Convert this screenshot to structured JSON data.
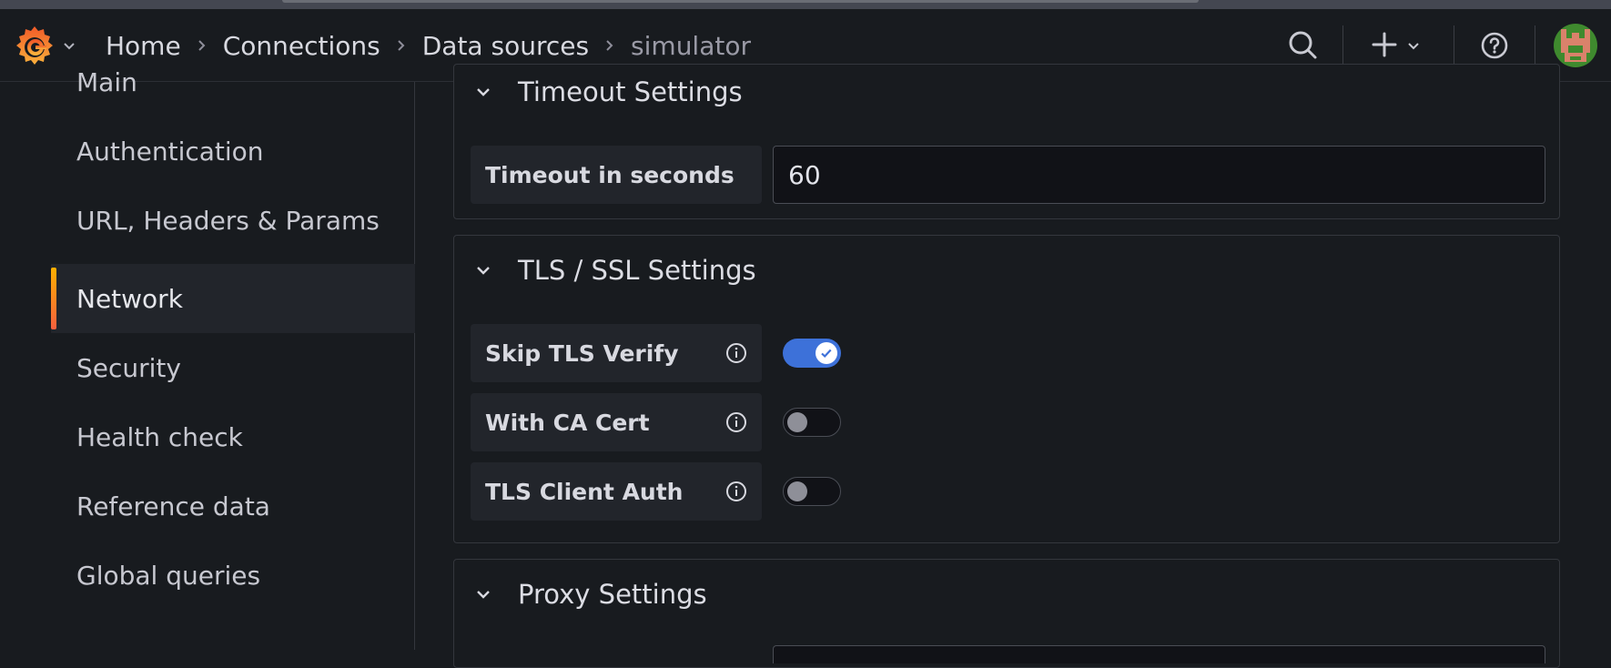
{
  "breadcrumb": {
    "items": [
      "Home",
      "Connections",
      "Data sources"
    ],
    "current": "simulator"
  },
  "icons": {
    "logo": "grafana-logo",
    "search": "search-icon",
    "add": "plus-icon",
    "help": "help-icon",
    "avatar": "user-avatar"
  },
  "sidebar": {
    "items": [
      {
        "label": "Main"
      },
      {
        "label": "Authentication"
      },
      {
        "label": "URL, Headers & Params"
      },
      {
        "label": "Network",
        "active": true
      },
      {
        "label": "Security"
      },
      {
        "label": "Health check"
      },
      {
        "label": "Reference data"
      },
      {
        "label": "Global queries"
      }
    ]
  },
  "timeout": {
    "title": "Timeout Settings",
    "field_label": "Timeout in seconds",
    "value": "60"
  },
  "tls": {
    "title": "TLS / SSL Settings",
    "fields": [
      {
        "label": "Skip TLS Verify",
        "enabled": true
      },
      {
        "label": "With CA Cert",
        "enabled": false
      },
      {
        "label": "TLS Client Auth",
        "enabled": false
      }
    ]
  },
  "proxy": {
    "title": "Proxy Settings"
  },
  "colors": {
    "background": "#181b1f",
    "accent": "#3d71d9",
    "active_indicator_start": "#ffb000",
    "active_indicator_end": "#f55f3e"
  }
}
